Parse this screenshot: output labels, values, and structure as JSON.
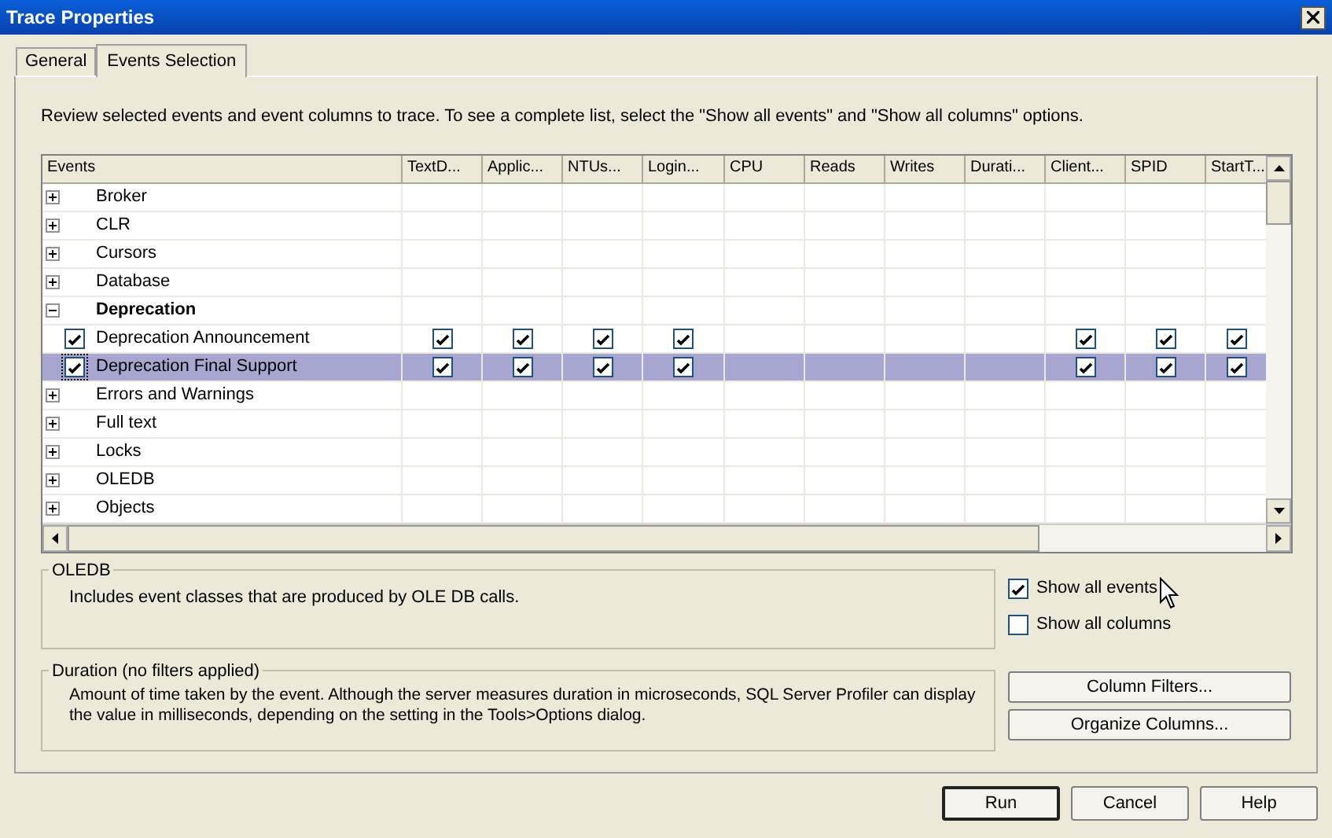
{
  "window": {
    "title": "Trace Properties"
  },
  "tabs": [
    {
      "label": "General",
      "selected": false
    },
    {
      "label": "Events Selection",
      "selected": true
    }
  ],
  "intro": "Review selected events and event columns to trace. To see a complete list, select the \"Show all events\" and \"Show all columns\" options.",
  "grid": {
    "columns": [
      "Events",
      "TextD...",
      "Applic...",
      "NTUs...",
      "Login...",
      "CPU",
      "Reads",
      "Writes",
      "Durati...",
      "Client...",
      "SPID",
      "StartT..."
    ],
    "rows": [
      {
        "kind": "category",
        "label": "Broker",
        "expanded": false,
        "selected": false
      },
      {
        "kind": "category",
        "label": "CLR",
        "expanded": false,
        "selected": false
      },
      {
        "kind": "category",
        "label": "Cursors",
        "expanded": false,
        "selected": false
      },
      {
        "kind": "category",
        "label": "Database",
        "expanded": false,
        "selected": false
      },
      {
        "kind": "category",
        "label": "Deprecation",
        "expanded": true,
        "selected": false
      },
      {
        "kind": "event",
        "label": "Deprecation Announcement",
        "checked": true,
        "selected": false,
        "cells": [
          true,
          true,
          true,
          true,
          false,
          false,
          false,
          false,
          true,
          true,
          true
        ]
      },
      {
        "kind": "event",
        "label": "Deprecation Final Support",
        "checked": true,
        "selected": true,
        "cells": [
          true,
          true,
          true,
          true,
          false,
          false,
          false,
          false,
          true,
          true,
          true
        ]
      },
      {
        "kind": "category",
        "label": "Errors and Warnings",
        "expanded": false,
        "selected": false
      },
      {
        "kind": "category",
        "label": "Full text",
        "expanded": false,
        "selected": false
      },
      {
        "kind": "category",
        "label": "Locks",
        "expanded": false,
        "selected": false
      },
      {
        "kind": "category",
        "label": "OLEDB",
        "expanded": false,
        "selected": false
      },
      {
        "kind": "category",
        "label": "Objects",
        "expanded": false,
        "selected": false
      }
    ]
  },
  "event_group": {
    "title": "OLEDB",
    "text": "Includes event classes that are produced by OLE DB calls."
  },
  "column_group": {
    "title": "Duration (no filters applied)",
    "text": "Amount of time taken by the event. Although the server measures duration in microseconds, SQL Server Profiler can display the value in milliseconds, depending on the setting in the Tools>Options dialog."
  },
  "options": [
    {
      "label": "Show all events",
      "checked": true
    },
    {
      "label": "Show all columns",
      "checked": false
    }
  ],
  "side_buttons": [
    "Column Filters...",
    "Organize Columns..."
  ],
  "buttons": [
    {
      "label": "Run",
      "default": true
    },
    {
      "label": "Cancel",
      "default": false
    },
    {
      "label": "Help",
      "default": false
    }
  ]
}
